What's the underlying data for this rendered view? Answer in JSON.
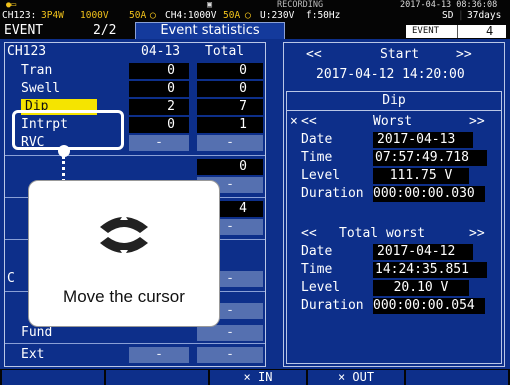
{
  "status": {
    "icons": [
      "power-icon",
      "storage-icon"
    ],
    "recording": "RECORDING",
    "datetime": "2017-04-13 08:36:08"
  },
  "channel_bar": {
    "ch": "CH123:",
    "wiring": "3P4W",
    "voltage": "1000V",
    "current1": "50A",
    "ch4": "CH4:1000V",
    "current2": "50A",
    "u": "U:230V",
    "f": "f:50Hz",
    "sd": "SD",
    "days": "37days"
  },
  "tabs": {
    "event": "EVENT",
    "page": "2/2",
    "title": "Event statistics",
    "event_label": "EVENT",
    "event_count": "4"
  },
  "table": {
    "headers": [
      "CH123",
      "04-13",
      "Total"
    ],
    "rows": [
      {
        "label": "Tran",
        "day": "0",
        "total": "0"
      },
      {
        "label": "Swell",
        "day": "0",
        "total": "0"
      },
      {
        "label": "Dip",
        "day": "2",
        "total": "7"
      },
      {
        "label": "Intrpt",
        "day": "0",
        "total": "1"
      },
      {
        "label": "RVC",
        "day": "-",
        "total": "-"
      },
      {
        "label": "",
        "day": "",
        "total": "0"
      },
      {
        "label": "",
        "day": "",
        "total": "-"
      },
      {
        "label": "",
        "day": "",
        "total": "4"
      },
      {
        "label": "",
        "day": "",
        "total": "-"
      },
      {
        "label": "",
        "day": "",
        "total": "-"
      },
      {
        "label": "C",
        "day": "",
        "total": "-"
      },
      {
        "label": "",
        "day": "",
        "total": "-"
      },
      {
        "label": "Fund",
        "day": "",
        "total": "-"
      },
      {
        "label": "Ext",
        "day": "-",
        "total": "-"
      }
    ]
  },
  "start": {
    "prev": "<<",
    "title": "Start",
    "next": ">>",
    "value": "2017-04-12 14:20:00"
  },
  "dip": {
    "title": "Dip",
    "worst": {
      "mark": "×",
      "prev": "<<",
      "title": "Worst",
      "next": ">>",
      "date_label": "Date",
      "date": "2017-04-13",
      "time_label": "Time",
      "time": "07:57:49.718",
      "level_label": "Level",
      "level": "111.75 V",
      "duration_label": "Duration",
      "duration": "000:00:00.030"
    },
    "total_worst": {
      "prev": "<<",
      "title": "Total worst",
      "next": ">>",
      "date_label": "Date",
      "date": "2017-04-12",
      "time_label": "Time",
      "time": "14:24:35.851",
      "level_label": "Level",
      "level": "20.10 V",
      "duration_label": "Duration",
      "duration": "000:00:00.054"
    }
  },
  "popup": {
    "text": "Move the cursor",
    "icon": "cursor-updown-icon"
  },
  "function_keys": [
    "",
    "",
    "",
    "× IN",
    "× OUT",
    ""
  ],
  "colors": {
    "background": "#0d2f8a",
    "highlight": "#f5e400",
    "accent": "#f1c21b"
  }
}
